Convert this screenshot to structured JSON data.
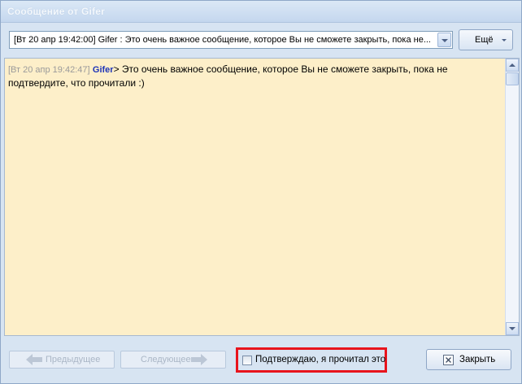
{
  "window": {
    "title": "Сообщение от Gifer"
  },
  "message_selector": {
    "selected": "[Вт 20 апр 19:42:00] Gifer : Это очень важное сообщение, которое Вы не сможете закрыть, пока не..."
  },
  "toolbar": {
    "more_label": "Ещё"
  },
  "chat": {
    "timestamp": "[Вт 20 апр 19:42:47]",
    "nick": "Gifer",
    "separator": ">",
    "text": " Это очень важное сообщение, которое Вы не сможете закрыть, пока не подтвердите, что прочитали :)"
  },
  "footer": {
    "prev_label": "Предыдущее",
    "next_label": "Следующее",
    "confirm_label": "Подтверждаю, я прочитал это",
    "confirm_checked": false,
    "close_label": "Закрыть"
  },
  "colors": {
    "chat_background": "#fdefc9",
    "highlight_border": "#e8141c",
    "nick": "#1f35b8"
  }
}
